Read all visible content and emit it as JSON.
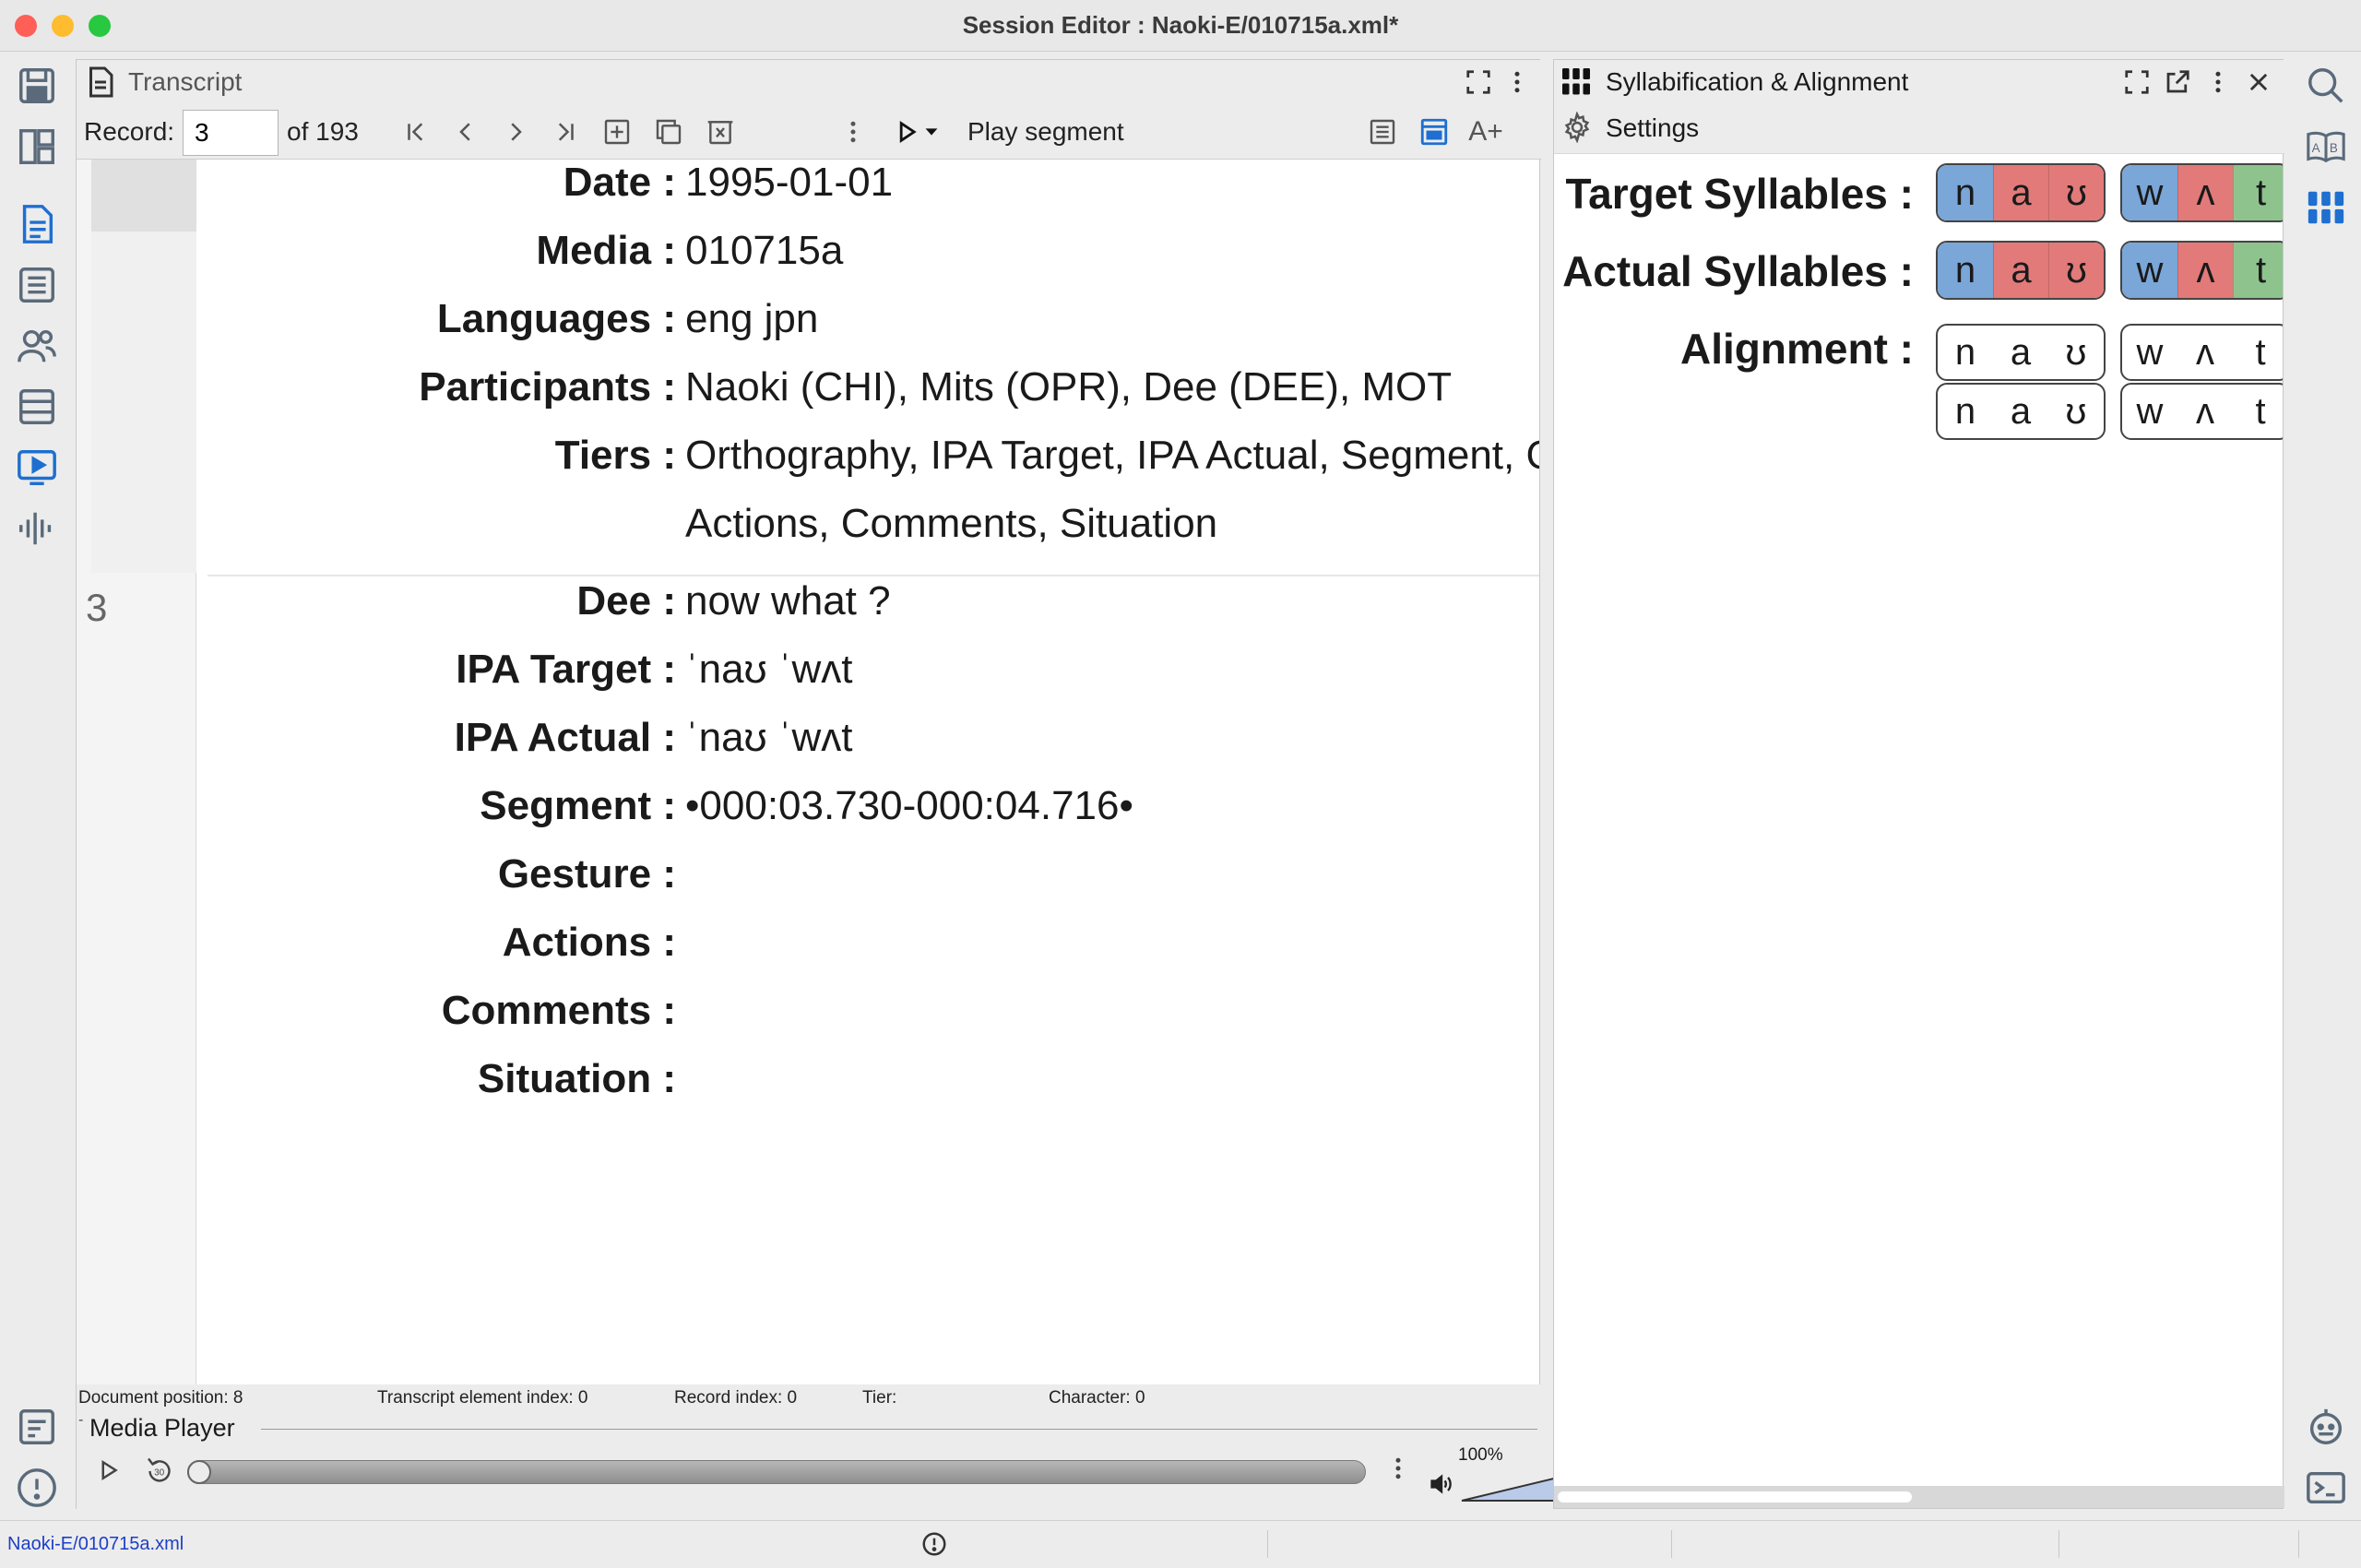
{
  "window": {
    "title": "Session Editor : Naoki-E/010715a.xml*"
  },
  "transcript": {
    "panel_title": "Transcript",
    "record_label": "Record:",
    "record_value": "3",
    "record_of": "of 193",
    "play_segment_label": "Play segment",
    "header_tiers": [
      {
        "label": "Date :",
        "value": "1995-01-01"
      },
      {
        "label": "Media :",
        "value": "010715a"
      },
      {
        "label": "Languages :",
        "value": "eng jpn"
      },
      {
        "label": "Participants :",
        "value": "Naoki (CHI), Mits (OPR), Dee (DEE), MOT"
      },
      {
        "label": "Tiers :",
        "value": "Orthography, IPA Target, IPA Actual, Segment, Gest",
        "value2": "Actions, Comments, Situation"
      }
    ],
    "record_number": "3",
    "record_tiers": [
      {
        "label": "Dee :",
        "value": "now what ?"
      },
      {
        "label": "IPA Target :",
        "value": "ˈnaʊ ˈwʌt"
      },
      {
        "label": "IPA Actual :",
        "value": "ˈnaʊ ˈwʌt"
      },
      {
        "label": "Segment :",
        "value": "•000:03.730-000:04.716•"
      },
      {
        "label": "Gesture :",
        "value": ""
      },
      {
        "label": "Actions :",
        "value": ""
      },
      {
        "label": "Comments :",
        "value": ""
      },
      {
        "label": "Situation :",
        "value": ""
      }
    ],
    "status": {
      "doc_position": "Document position: 8",
      "element_index": "Transcript element index: 0",
      "record_index": "Record index: 0",
      "tier": "Tier:",
      "character": "Character: 0"
    },
    "media_player": {
      "title": "Media Player",
      "volume": "100%",
      "skip_label": "30"
    }
  },
  "syllabification": {
    "panel_title": "Syllabification & Alignment",
    "settings_label": "Settings",
    "target_label": "Target Syllables :",
    "actual_label": "Actual Syllables :",
    "alignment_label": "Alignment :",
    "target": [
      [
        {
          "p": "n",
          "role": "onset"
        },
        {
          "p": "a",
          "role": "nucleus"
        },
        {
          "p": "ʊ",
          "role": "nucleus"
        }
      ],
      [
        {
          "p": "w",
          "role": "onset"
        },
        {
          "p": "ʌ",
          "role": "nucleus"
        },
        {
          "p": "t",
          "role": "coda"
        }
      ]
    ],
    "actual": [
      [
        {
          "p": "n",
          "role": "onset"
        },
        {
          "p": "a",
          "role": "nucleus"
        },
        {
          "p": "ʊ",
          "role": "nucleus"
        }
      ],
      [
        {
          "p": "w",
          "role": "onset"
        },
        {
          "p": "ʌ",
          "role": "nucleus"
        },
        {
          "p": "t",
          "role": "coda"
        }
      ]
    ],
    "alignment_top": [
      [
        "n",
        "a",
        "ʊ"
      ],
      [
        "w",
        "ʌ",
        "t"
      ]
    ],
    "alignment_bottom": [
      [
        "n",
        "a",
        "ʊ"
      ],
      [
        "w",
        "ʌ",
        "t"
      ]
    ],
    "colors": {
      "onset": "#7aa6d8",
      "nucleus": "#e27a7a",
      "coda": "#8ec38e"
    }
  },
  "app_status": {
    "file": "Naoki-E/010715a.xml"
  },
  "colors": {
    "accent": "#1e6fd0",
    "link": "#1d3fc7"
  }
}
